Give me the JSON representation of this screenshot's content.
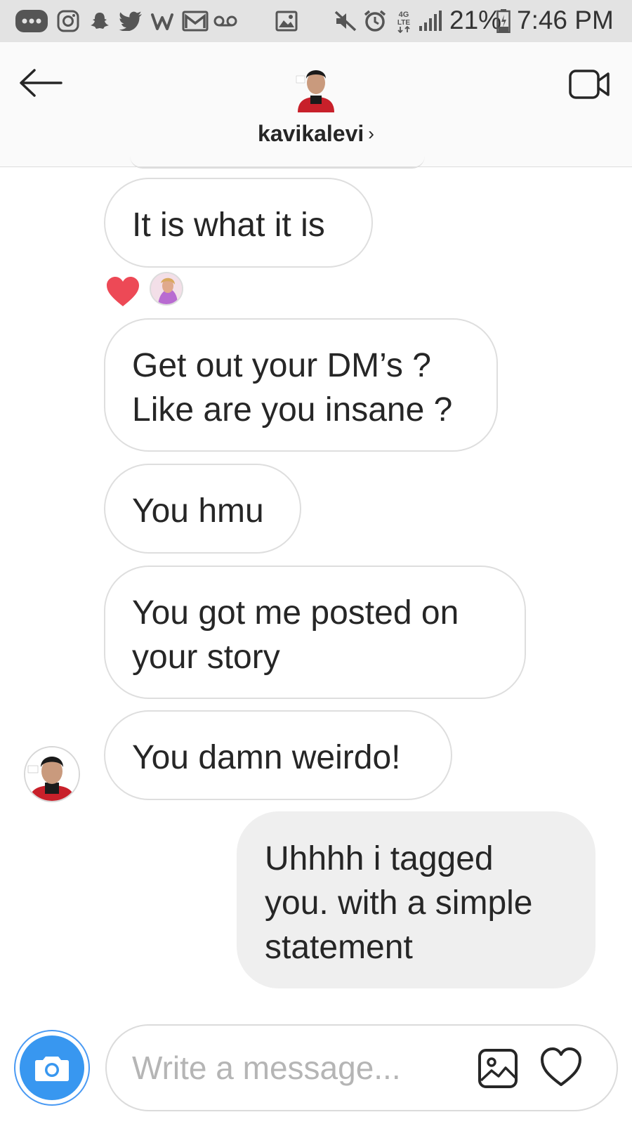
{
  "status_bar": {
    "battery": "21%",
    "time": "7:46 PM",
    "network": "4G LTE"
  },
  "header": {
    "username": "kavikalevi",
    "chevron": "›"
  },
  "messages": [
    {
      "text_lines": [
        "It is what it is"
      ],
      "direction": "received",
      "reaction": "heart"
    },
    {
      "text_lines": [
        "Get out your DM’s ?",
        "Like are you insane ?"
      ],
      "direction": "received"
    },
    {
      "text_lines": [
        "You hmu"
      ],
      "direction": "received"
    },
    {
      "text_lines": [
        "You got me posted on",
        "your story"
      ],
      "direction": "received"
    },
    {
      "text_lines": [
        "You damn weirdo!"
      ],
      "direction": "received"
    },
    {
      "text_lines": [
        "Uhhhh i tagged",
        "you. with a simple",
        "statement"
      ],
      "direction": "sent"
    }
  ],
  "composer": {
    "placeholder": "Write a message..."
  },
  "icons": {
    "back": "back-arrow-icon",
    "video": "video-call-icon",
    "camera": "camera-icon",
    "gallery": "gallery-icon",
    "like": "heart-outline-icon",
    "reaction": "heart-filled-icon"
  },
  "colors": {
    "accent": "#3897f0",
    "reaction_heart": "#ed4956",
    "sent_bubble": "#efefef",
    "status_bar": "#e3e3e3"
  }
}
